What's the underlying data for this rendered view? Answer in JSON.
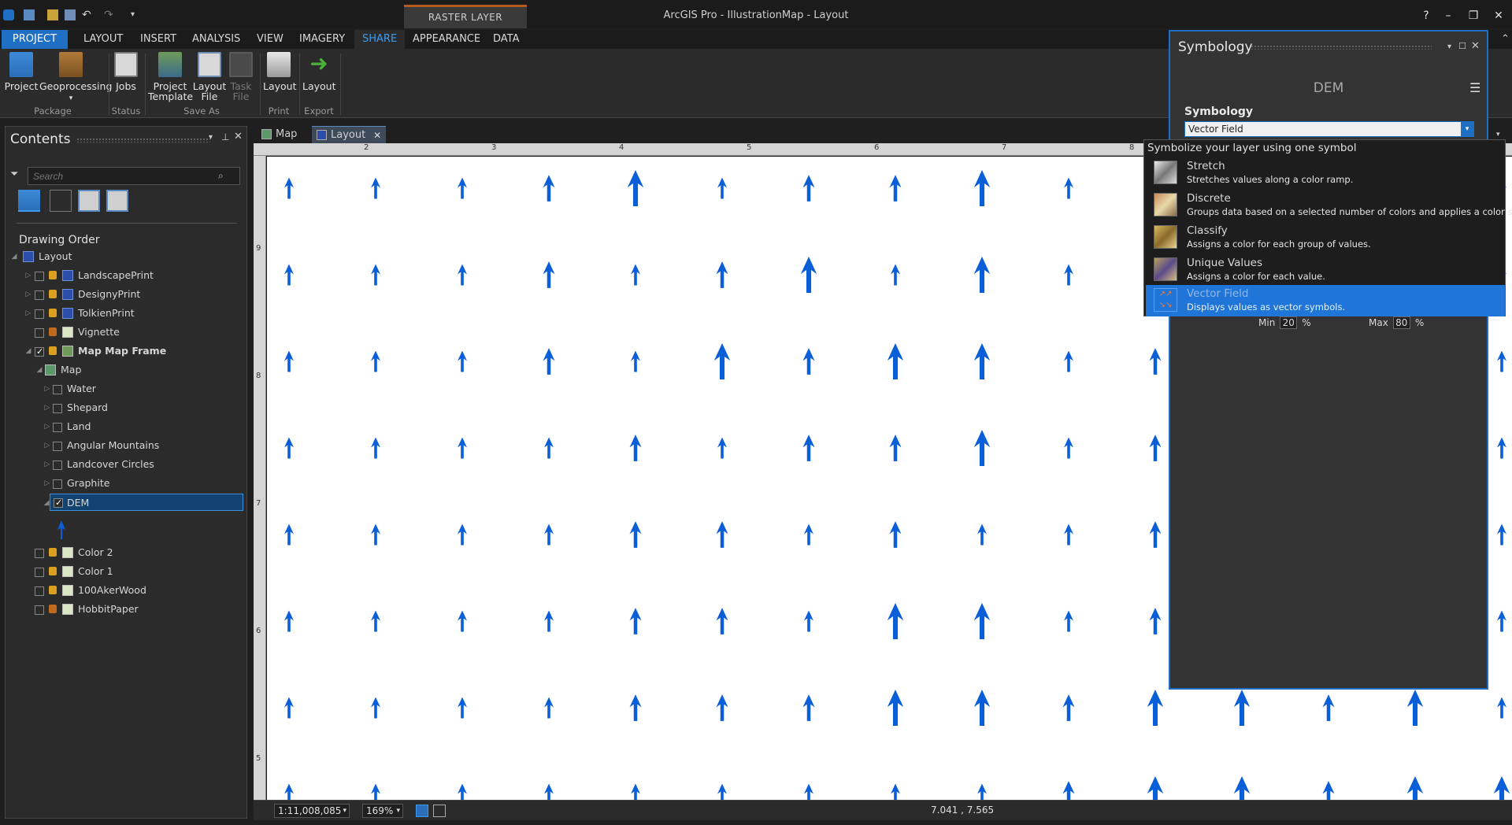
{
  "window": {
    "title": "ArcGIS Pro - IllustrationMap - Layout",
    "context_tab": "RASTER LAYER"
  },
  "ribbon_tabs": [
    "PROJECT",
    "LAYOUT",
    "INSERT",
    "ANALYSIS",
    "VIEW",
    "IMAGERY",
    "SHARE",
    "APPEARANCE",
    "DATA"
  ],
  "ribbon": {
    "buttons": {
      "project": "Project",
      "geoprocessing": "Geoprocessing",
      "jobs": "Jobs",
      "project_template_1": "Project",
      "project_template_2": "Template",
      "layout_file_1": "Layout",
      "layout_file_2": "File",
      "task_file_1": "Task",
      "task_file_2": "File",
      "print_layout": "Layout",
      "export_layout": "Layout"
    },
    "groups": {
      "package": "Package",
      "status": "Status",
      "save_as": "Save As",
      "print": "Print",
      "export": "Export"
    }
  },
  "contents": {
    "title": "Contents",
    "search_placeholder": "Search",
    "drawing_order": "Drawing Order",
    "items": {
      "layout": "Layout",
      "landscape": "LandscapePrint",
      "designy": "DesignyPrint",
      "tolkien": "TolkienPrint",
      "vignette": "Vignette",
      "mapframe": "Map Map Frame",
      "map": "Map",
      "water": "Water",
      "shepard": "Shepard",
      "land": "Land",
      "angular": "Angular Mountains",
      "landcover": "Landcover Circles",
      "graphite": "Graphite",
      "dem": "DEM",
      "color2": "Color 2",
      "color1": "Color 1",
      "aker": "100AkerWood",
      "hobbit": "HobbitPaper"
    }
  },
  "view_tabs": {
    "map": "Map",
    "layout": "Layout"
  },
  "ruler": {
    "top": [
      "2",
      "3",
      "4",
      "5",
      "6",
      "7",
      "8"
    ],
    "left": [
      "9",
      "8",
      "7",
      "6",
      "5"
    ]
  },
  "status": {
    "scale": "1:11,008,085",
    "zoom": "169%",
    "coords": "7.041 , 7.565"
  },
  "symbology": {
    "title": "Symbology",
    "layer": "DEM",
    "section": "Symbology",
    "selected": "Vector Field",
    "min_label": "Min",
    "min_value": "20",
    "max_label": "Max",
    "max_value": "80",
    "percent": "%",
    "dropdown_header": "Symbolize your layer using one symbol",
    "options": {
      "stretch": {
        "name": "Stretch",
        "desc": "Stretches values along a color ramp."
      },
      "discrete": {
        "name": "Discrete",
        "desc": "Groups data based on a selected number of colors and applies a color scheme."
      },
      "classify": {
        "name": "Classify",
        "desc": "Assigns a color for each group of values."
      },
      "unique": {
        "name": "Unique Values",
        "desc": "Assigns a color for each value."
      },
      "vector": {
        "name": "Vector Field",
        "desc": "Displays values as vector symbols."
      }
    }
  },
  "colors": {
    "accent": "#1f6fc4",
    "arrow": "#0a5ed8",
    "context": "#b35a1f"
  }
}
